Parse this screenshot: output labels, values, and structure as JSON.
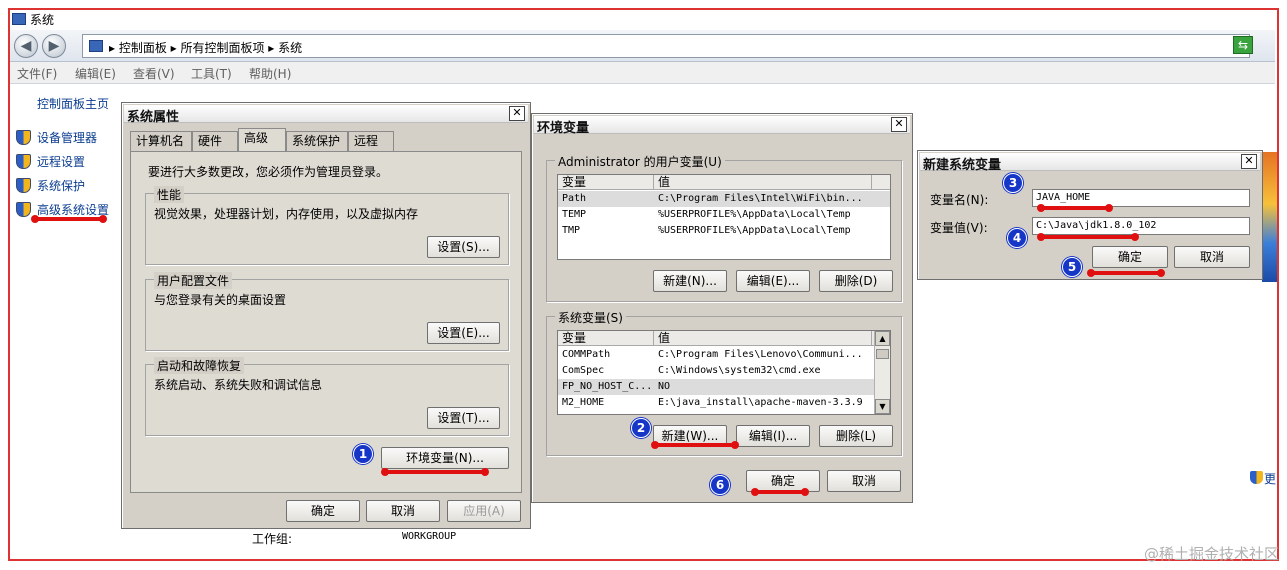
{
  "window": {
    "title": "系统"
  },
  "address": {
    "breadcrumb": "▸ 控制面板 ▸ 所有控制面板项 ▸ 系统"
  },
  "menu": [
    "文件(F)",
    "编辑(E)",
    "查看(V)",
    "工具(T)",
    "帮助(H)"
  ],
  "left_pane": {
    "home": "控制面板主页",
    "tasks": [
      "设备管理器",
      "远程设置",
      "系统保护",
      "高级系统设置"
    ]
  },
  "background": {
    "workgroup_label": "工作组:",
    "workgroup_value": "WORKGROUP",
    "right_link": "更"
  },
  "sysprops": {
    "title": "系统属性",
    "tabs": [
      "计算机名",
      "硬件",
      "高级",
      "系统保护",
      "远程"
    ],
    "notice": "要进行大多数更改，您必须作为管理员登录。",
    "perf_title": "性能",
    "perf_desc": "视觉效果，处理器计划，内存使用，以及虚拟内存",
    "perf_btn": "设置(S)...",
    "profile_title": "用户配置文件",
    "profile_desc": "与您登录有关的桌面设置",
    "profile_btn": "设置(E)...",
    "startup_title": "启动和故障恢复",
    "startup_desc": "系统启动、系统失败和调试信息",
    "startup_btn": "设置(T)...",
    "env_btn": "环境变量(N)...",
    "ok": "确定",
    "cancel": "取消",
    "apply": "应用(A)"
  },
  "envvars": {
    "title": "环境变量",
    "user_group": "Administrator 的用户变量(U)",
    "col_var": "变量",
    "col_val": "值",
    "user_rows": [
      {
        "name": "Path",
        "value": "C:\\Program Files\\Intel\\WiFi\\bin..."
      },
      {
        "name": "TEMP",
        "value": "%USERPROFILE%\\AppData\\Local\\Temp"
      },
      {
        "name": "TMP",
        "value": "%USERPROFILE%\\AppData\\Local\\Temp"
      }
    ],
    "user_new": "新建(N)...",
    "user_edit": "编辑(E)...",
    "user_delete": "删除(D)",
    "sys_group": "系统变量(S)",
    "sys_rows": [
      {
        "name": "COMMPath",
        "value": "C:\\Program Files\\Lenovo\\Communi..."
      },
      {
        "name": "ComSpec",
        "value": "C:\\Windows\\system32\\cmd.exe"
      },
      {
        "name": "FP_NO_HOST_C...",
        "value": "NO"
      },
      {
        "name": "M2_HOME",
        "value": "E:\\java_install\\apache-maven-3.3.9"
      }
    ],
    "sys_new": "新建(W)...",
    "sys_edit": "编辑(I)...",
    "sys_delete": "删除(L)",
    "ok": "确定",
    "cancel": "取消"
  },
  "newvar": {
    "title": "新建系统变量",
    "name_label": "变量名(N):",
    "name_value": "JAVA_HOME",
    "value_label": "变量值(V):",
    "value_value": "C:\\Java\\jdk1.8.0_102",
    "ok": "确定",
    "cancel": "取消"
  },
  "steps": [
    "1",
    "2",
    "3",
    "4",
    "5",
    "6"
  ],
  "watermark": "@稀土掘金技术社区",
  "colors": {
    "annotation_red": "#e01010",
    "badge_blue": "#1636c8"
  }
}
